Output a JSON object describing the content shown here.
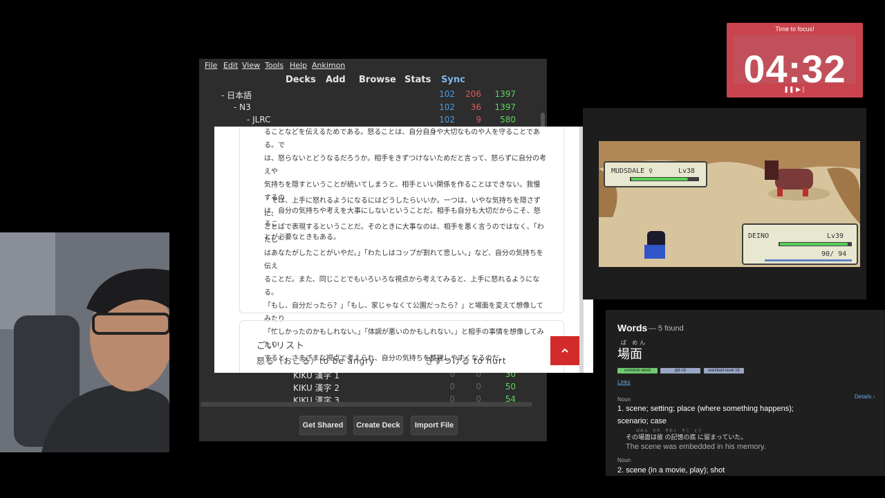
{
  "timer": {
    "label": "Time to focus!",
    "time": "04:32",
    "controls": "❚❚ ▶❘"
  },
  "anki": {
    "menu": [
      "File",
      "Edit",
      "View",
      "Tools",
      "Help",
      "Ankimon"
    ],
    "toolbar": [
      "Decks",
      "Add",
      "Browse",
      "Stats",
      "Sync"
    ],
    "decks": [
      {
        "name": "- 日本語",
        "new": "102",
        "learn": "206",
        "due": "1397"
      },
      {
        "name": "- N3",
        "new": "102",
        "learn": "36",
        "due": "1397"
      },
      {
        "name": "- JLRC",
        "new": "102",
        "learn": "9",
        "due": "580"
      },
      {
        "name": "KIKU 漢字 1",
        "new": "0",
        "learn": "0",
        "due": "30"
      },
      {
        "name": "KIKU 漢字 2",
        "new": "0",
        "learn": "0",
        "due": "50"
      },
      {
        "name": "KIKU 漢字 3",
        "new": "0",
        "learn": "0",
        "due": "54"
      }
    ],
    "buttons": [
      "Get Shared",
      "Create Deck",
      "Import File"
    ]
  },
  "article": {
    "paragraphs": [
      [
        "ることなどを伝えるためである。怒ることは、自分自身や大切なものや人を守ることである。で",
        "は、怒らないとどうなるだろうか。相手をきずつけないためだと言って、怒らずに自分の考えや",
        "気持ちを隠すということが続いてしまうと、相手といい関係を作ることはできない。我慢するの",
        "は、自分の気持ちや考えを大事にしないということだ。相手も自分も大切だからこそ、怒るこ",
        "とが必要なときもある。"
      ],
      [
        "　では、上手に怒れるようになるにはどうしたらいいか。一つは、いやな気持ちを隠さずに、",
        "ことばで表現するということだ。そのときに大事なのは、相手を悪く言うのではなく、「わたし",
        "はあなたがしたことがいやだ。」「わたしはコップが割れて悲しい。」など、自分の気持ちを伝え",
        "ることだ。また、同じことでもいろいろな視点から考えてみると、上手に怒れるようになる。",
        "「もし、自分だったら？」「もし、家じゃなくて公園だったら？」と場面を変えて想像してみたり",
        "「忙しかったのかもしれない。」「体調が悪いのかもしれない。」と相手の事情を想像してみたり",
        "すると、さまざまな視点で考えられ、自分の気持ちを整理しやすくなるのだ。"
      ]
    ],
    "list_title": "ごいリスト",
    "vocab": [
      "怒る（おこる）to be angry",
      "きずつける to hurt"
    ],
    "up_button": "^"
  },
  "game": {
    "enemy_name": "MUDSDALE ♀",
    "enemy_level": "Lv38",
    "enemy_hp_fraction": 0.85,
    "player_name": "DEINO",
    "player_level": "Lv39",
    "player_hp": "90/ 94",
    "player_hp_fraction": 0.96,
    "colors": {
      "hp_green": "#58d058",
      "ground": "#d8c49c",
      "rock": "#b08858"
    }
  },
  "dictionary": {
    "header": "Words",
    "found": "— 5 found",
    "furigana": "ば めん",
    "word": "場面",
    "tags": [
      "common word",
      "jlpt n3",
      "wanikani level 16"
    ],
    "links": "Links",
    "pos1": "Noun",
    "details": "Details ›",
    "def1_line1": "1.  scene; setting; place (where something happens);",
    "def1_line2": "scenario; case",
    "example_furi": "ばめん　かれ　きおく　そこ　とど",
    "example_ja": "その場面は彼 の記憶の底 に留まっていた。",
    "example_en": "The scene was embedded in his memory.",
    "pos2": "Noun",
    "def2": "2.  scene (in a movie, play); shot"
  }
}
